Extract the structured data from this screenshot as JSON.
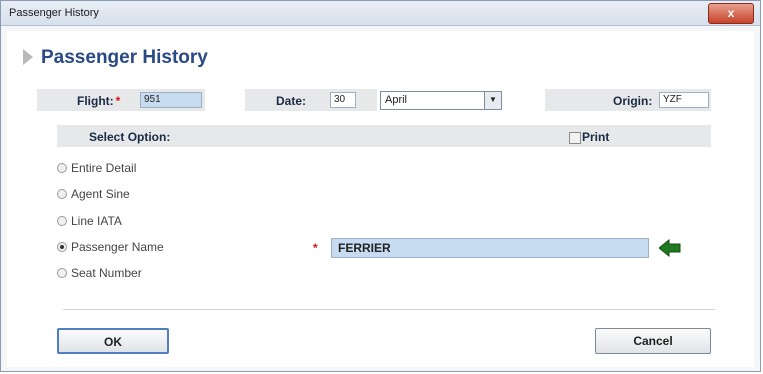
{
  "window": {
    "title": "Passenger History",
    "close_label": "x"
  },
  "header": {
    "title": "Passenger History"
  },
  "flight": {
    "label": "Flight:",
    "required": "*",
    "value": "951"
  },
  "date": {
    "label": "Date:",
    "day": "30",
    "month": "April"
  },
  "origin": {
    "label": "Origin:",
    "value": "YZF"
  },
  "select_option": {
    "label": "Select Option:"
  },
  "print": {
    "label": "Print",
    "checked": false
  },
  "options": [
    {
      "label": "Entire  Detail",
      "selected": false
    },
    {
      "label": "Agent Sine",
      "selected": false
    },
    {
      "label": "Line IATA",
      "selected": false
    },
    {
      "label": "Passenger Name",
      "selected": true
    },
    {
      "label": "Seat Number",
      "selected": false
    }
  ],
  "passenger_name": {
    "required": "*",
    "value": "FERRIER"
  },
  "buttons": {
    "ok": "OK",
    "cancel": "Cancel"
  },
  "colors": {
    "header_text": "#2a4a86",
    "highlight_input": "#c7dcf1",
    "arrow_green": "#1f7a1f",
    "close_red": "#c7422a"
  }
}
